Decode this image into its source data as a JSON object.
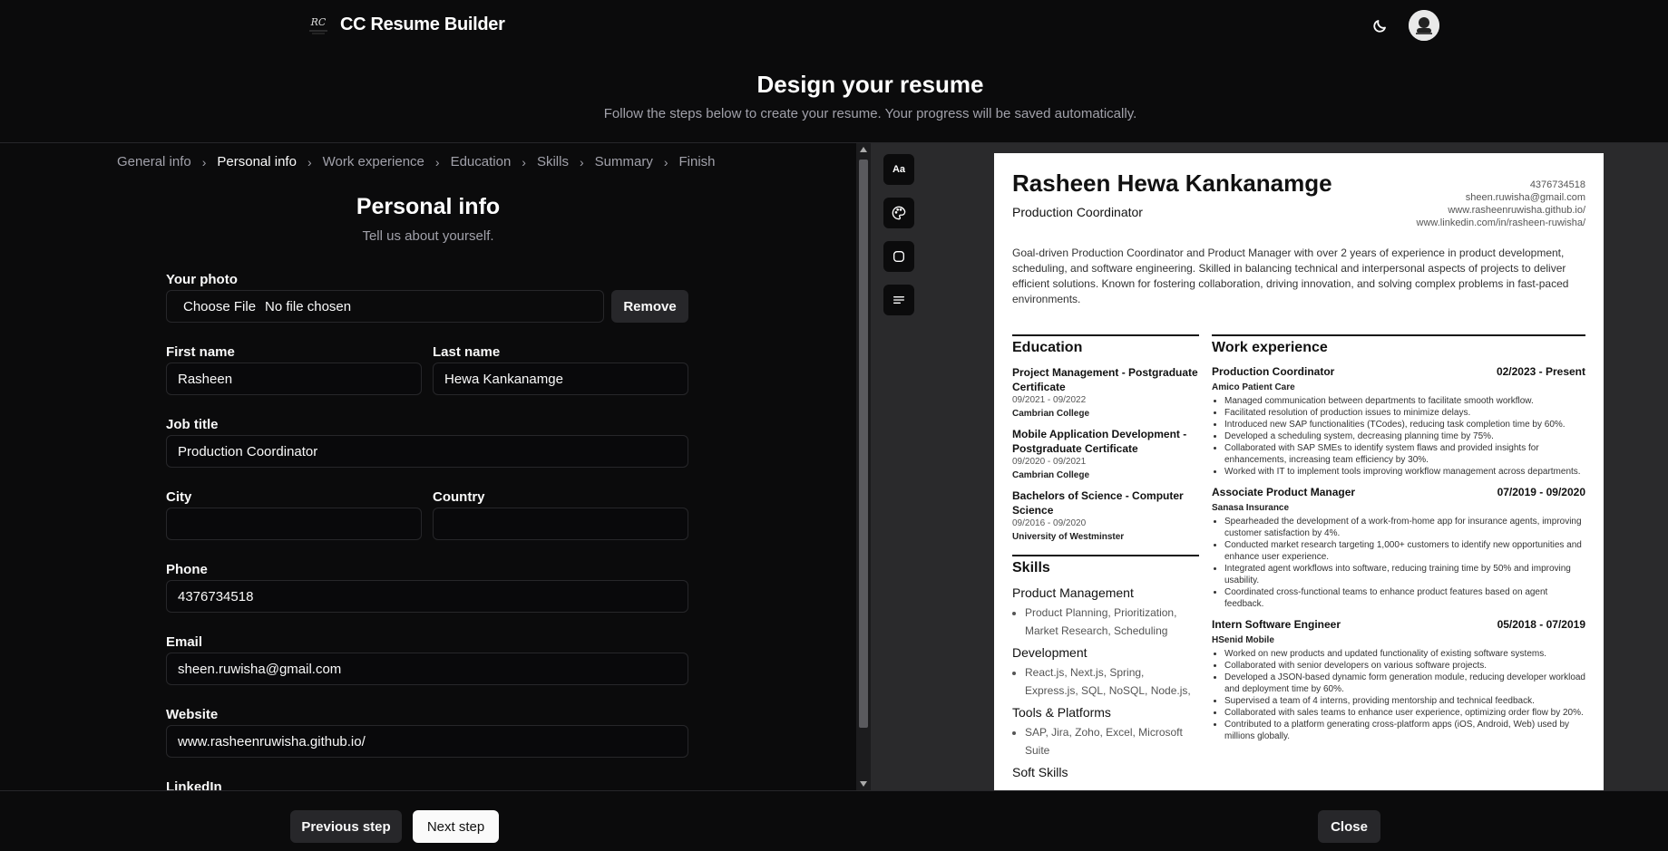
{
  "app": {
    "title": "CC Resume Builder"
  },
  "hero": {
    "title": "Design your resume",
    "subtitle": "Follow the steps below to create your resume. Your progress will be saved automatically."
  },
  "steps": [
    {
      "label": "General info",
      "active": false
    },
    {
      "label": "Personal info",
      "active": true
    },
    {
      "label": "Work experience",
      "active": false
    },
    {
      "label": "Education",
      "active": false
    },
    {
      "label": "Skills",
      "active": false
    },
    {
      "label": "Summary",
      "active": false
    },
    {
      "label": "Finish",
      "active": false
    }
  ],
  "form": {
    "title": "Personal info",
    "subtitle": "Tell us about yourself.",
    "photo_label": "Your photo",
    "choose_file": "Choose File",
    "no_file": "No file chosen",
    "remove": "Remove",
    "first_name_label": "First name",
    "first_name": "Rasheen",
    "last_name_label": "Last name",
    "last_name": "Hewa Kankanamge",
    "job_title_label": "Job title",
    "job_title": "Production Coordinator",
    "city_label": "City",
    "city": "",
    "country_label": "Country",
    "country": "",
    "phone_label": "Phone",
    "phone": "4376734518",
    "email_label": "Email",
    "email": "sheen.ruwisha@gmail.com",
    "website_label": "Website",
    "website": "www.rasheenruwisha.github.io/",
    "linkedin_label": "LinkedIn"
  },
  "tools": {
    "font_label": "Aa"
  },
  "resume": {
    "name": "Rasheen Hewa Kankanamge",
    "job_title": "Production Coordinator",
    "phone": "4376734518",
    "email": "sheen.ruwisha@gmail.com",
    "website": "www.rasheenruwisha.github.io/",
    "linkedin": "www.linkedin.com/in/rasheen-ruwisha/",
    "summary": "Goal-driven Production Coordinator and Product Manager with over 2 years of experience in product development, scheduling, and software engineering. Skilled in balancing technical and interpersonal aspects of projects to deliver efficient solutions. Known for fostering collaboration, driving innovation, and solving complex problems in fast-paced environments.",
    "education_heading": "Education",
    "education": [
      {
        "degree": "Project Management - Postgraduate Certificate",
        "dates": "09/2021 - 09/2022",
        "school": "Cambrian College"
      },
      {
        "degree": "Mobile Application Development - Postgraduate Certificate",
        "dates": "09/2020 - 09/2021",
        "school": "Cambrian College"
      },
      {
        "degree": "Bachelors of Science - Computer Science",
        "dates": "09/2016 - 09/2020",
        "school": "University of Westminster"
      }
    ],
    "skills_heading": "Skills",
    "skills": [
      {
        "category": "Product Management",
        "items": "Product Planning, Prioritization, Market Research, Scheduling"
      },
      {
        "category": "Development",
        "items": "React.js, Next.js, Spring, Express.js, SQL, NoSQL, Node.js,"
      },
      {
        "category": "Tools & Platforms",
        "items": "SAP, Jira, Zoho, Excel, Microsoft Suite"
      },
      {
        "category": "Soft Skills",
        "items": ""
      }
    ],
    "work_heading": "Work experience",
    "work": [
      {
        "title": "Production Coordinator",
        "dates": "02/2023 - Present",
        "company": "Amico Patient Care",
        "bullets": [
          "Managed communication between departments to facilitate smooth workflow.",
          "Facilitated resolution of production issues to minimize delays.",
          "Introduced new SAP functionalities (TCodes), reducing task completion time by 60%.",
          "Developed a scheduling system, decreasing planning time by 75%.",
          "Collaborated with SAP SMEs to identify system flaws and provided insights for enhancements, increasing team efficiency by 30%.",
          "Worked with IT to implement tools improving workflow management across departments."
        ]
      },
      {
        "title": "Associate Product Manager",
        "dates": "07/2019 - 09/2020",
        "company": "Sanasa Insurance",
        "bullets": [
          "Spearheaded the development of a work-from-home app for insurance agents, improving customer satisfaction by 4%.",
          "Conducted market research targeting 1,000+ customers to identify new opportunities and enhance user experience.",
          "Integrated agent workflows into software, reducing training time by 50% and improving usability.",
          "Coordinated cross-functional teams to enhance product features based on agent feedback."
        ]
      },
      {
        "title": "Intern Software Engineer",
        "dates": "05/2018 - 07/2019",
        "company": "HSenid Mobile",
        "bullets": [
          "Worked on new products and updated functionality of existing software systems.",
          "Collaborated with senior developers on various software projects.",
          "Developed a JSON-based dynamic form generation module, reducing developer workload and deployment time by 60%.",
          "Supervised a team of 4 interns, providing mentorship and technical feedback.",
          "Collaborated with sales teams to enhance user experience, optimizing order flow by 20%.",
          "Contributed to a platform generating cross-platform apps (iOS, Android, Web) used by millions globally."
        ]
      }
    ]
  },
  "footer": {
    "previous": "Previous step",
    "next": "Next step",
    "close": "Close"
  }
}
